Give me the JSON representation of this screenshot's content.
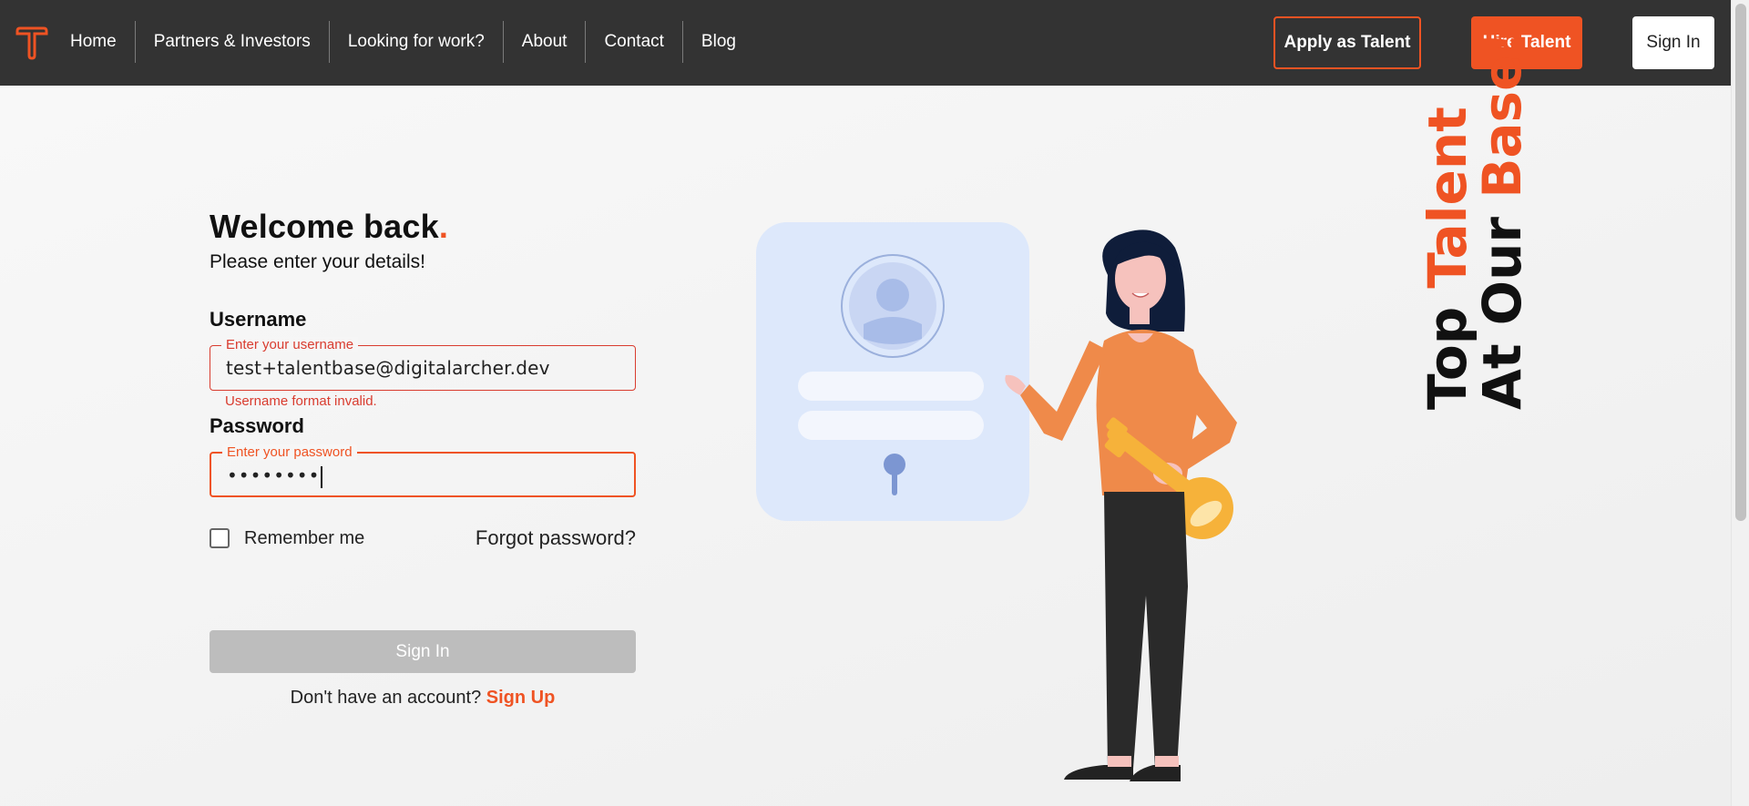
{
  "nav": {
    "links": [
      "Home",
      "Partners & Investors",
      "Looking for work?",
      "About",
      "Contact",
      "Blog"
    ],
    "apply_label": "Apply as Talent",
    "hire_label": "Hire Talent",
    "signin_label": "Sign In"
  },
  "form": {
    "title": "Welcome back",
    "title_dot": ".",
    "subtitle": "Please enter your details!",
    "username": {
      "label": "Username",
      "legend": "Enter your username",
      "value": "test+talentbase@digitalarcher.dev",
      "error": "Username format invalid."
    },
    "password": {
      "label": "Password",
      "legend": "Enter your password",
      "value": "••••••••"
    },
    "remember_label": "Remember me",
    "forgot_label": "Forgot password?",
    "signin_label": "Sign In",
    "no_account_text": "Don't have an account?",
    "signup_label": "Sign Up"
  },
  "tagline": {
    "line1_a": "Top ",
    "line1_b": "Talent",
    "line2_a": "At Our ",
    "line2_b": "Base!"
  },
  "colors": {
    "accent": "#ef5323",
    "navbar": "#333333",
    "error": "#d93c2f"
  }
}
